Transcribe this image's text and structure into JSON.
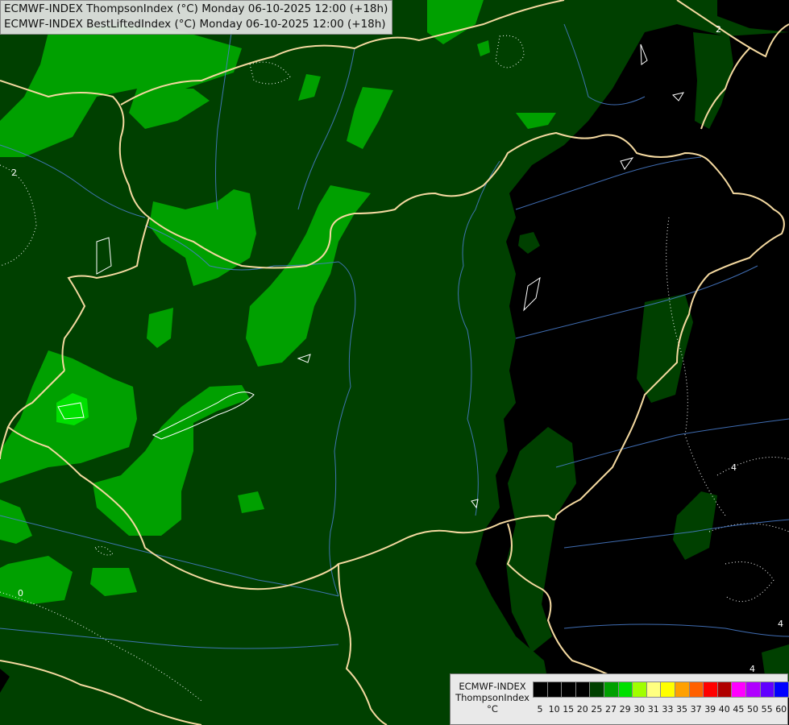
{
  "header": {
    "line1": "ECMWF-INDEX ThompsonIndex (°C) Monday 06-10-2025 12:00 (+18h)",
    "line2": "ECMWF-INDEX BestLiftedIndex (°C) Monday 06-10-2025 12:00 (+18h)"
  },
  "legend": {
    "model": "ECMWF-INDEX",
    "parameter": "ThompsonIndex",
    "unit": "°C",
    "stops": [
      {
        "label": "5",
        "color": "#000000"
      },
      {
        "label": "10",
        "color": "#000000"
      },
      {
        "label": "15",
        "color": "#000000"
      },
      {
        "label": "20",
        "color": "#000000"
      },
      {
        "label": "25",
        "color": "#004000"
      },
      {
        "label": "27",
        "color": "#00a000"
      },
      {
        "label": "29",
        "color": "#00e000"
      },
      {
        "label": "30",
        "color": "#a0ff00"
      },
      {
        "label": "31",
        "color": "#ffff80"
      },
      {
        "label": "33",
        "color": "#ffff00"
      },
      {
        "label": "35",
        "color": "#ffa000"
      },
      {
        "label": "37",
        "color": "#ff6000"
      },
      {
        "label": "39",
        "color": "#ff0000"
      },
      {
        "label": "40",
        "color": "#b00000"
      },
      {
        "label": "45",
        "color": "#ff00ff"
      },
      {
        "label": "50",
        "color": "#b000ff"
      },
      {
        "label": "55",
        "color": "#6000ff"
      },
      {
        "label": "60",
        "color": "#0000ff"
      }
    ]
  },
  "contour_labels": [
    "2",
    "0",
    "2",
    "4",
    "4",
    "4"
  ],
  "colors": {
    "background": "#004000",
    "low": "#000000",
    "mid": "#00a000",
    "high": "#00e000",
    "borders": "#f4d9a0",
    "rivers": "#4a7fd0"
  }
}
